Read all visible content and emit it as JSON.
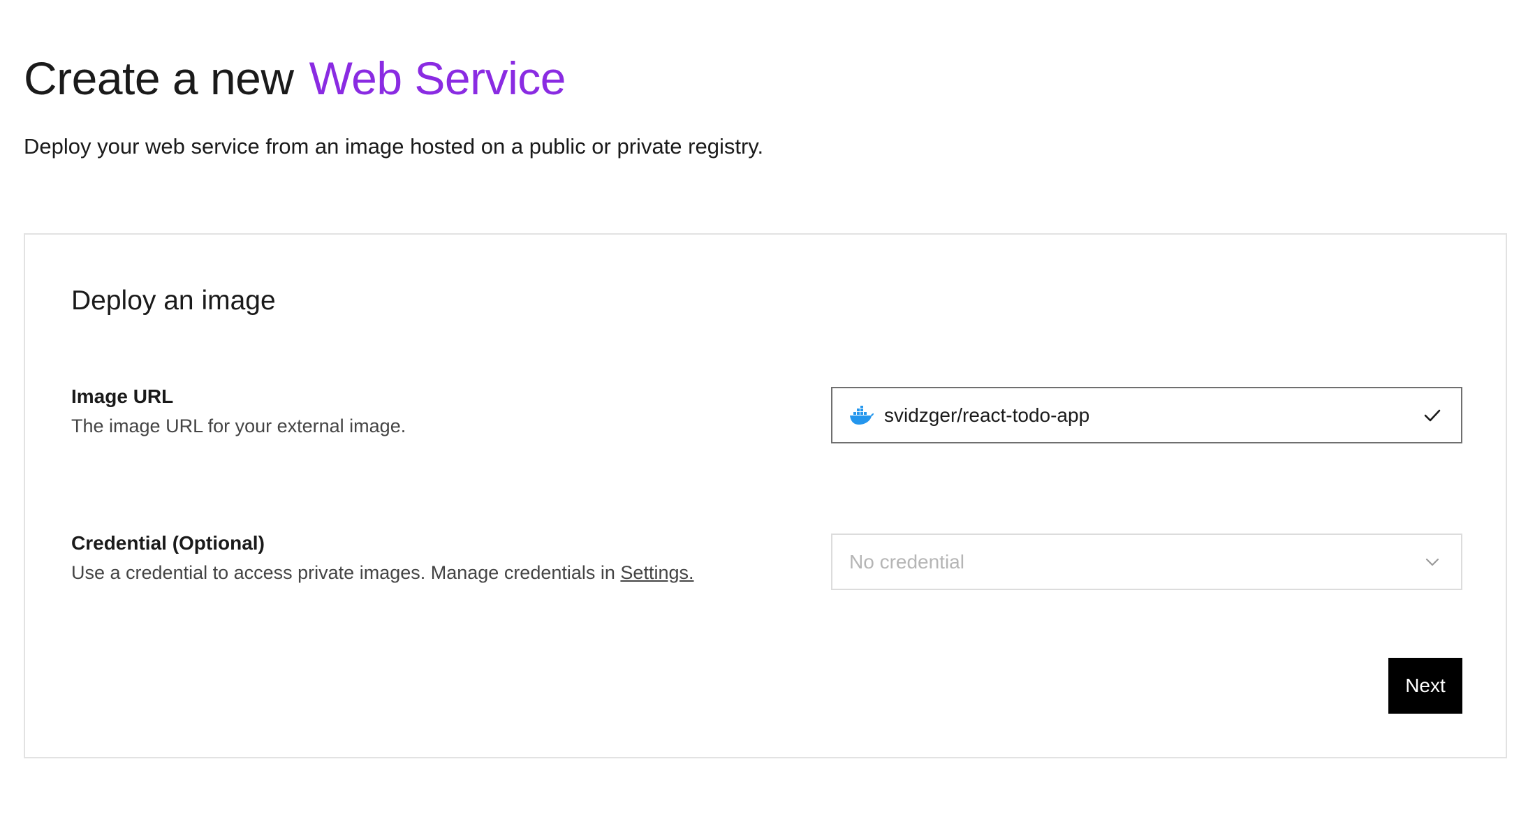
{
  "header": {
    "title_prefix": "Create a new",
    "title_accent": "Web Service",
    "subtitle": "Deploy your web service from an image hosted on a public or private registry."
  },
  "card": {
    "title": "Deploy an image",
    "image_url": {
      "label": "Image URL",
      "help": "The image URL for your external image.",
      "value": "svidzger/react-todo-app",
      "leading_icon": "docker-icon",
      "trailing_icon": "check-icon"
    },
    "credential": {
      "label": "Credential (Optional)",
      "help_prefix": "Use a credential to access private images. Manage credentials in",
      "help_link": "Settings.",
      "placeholder": "No credential",
      "trailing_icon": "chevron-down-icon"
    },
    "next_label": "Next"
  },
  "colors": {
    "accent": "#8a2be2",
    "docker_blue": "#2496ed",
    "button_bg": "#000000"
  }
}
